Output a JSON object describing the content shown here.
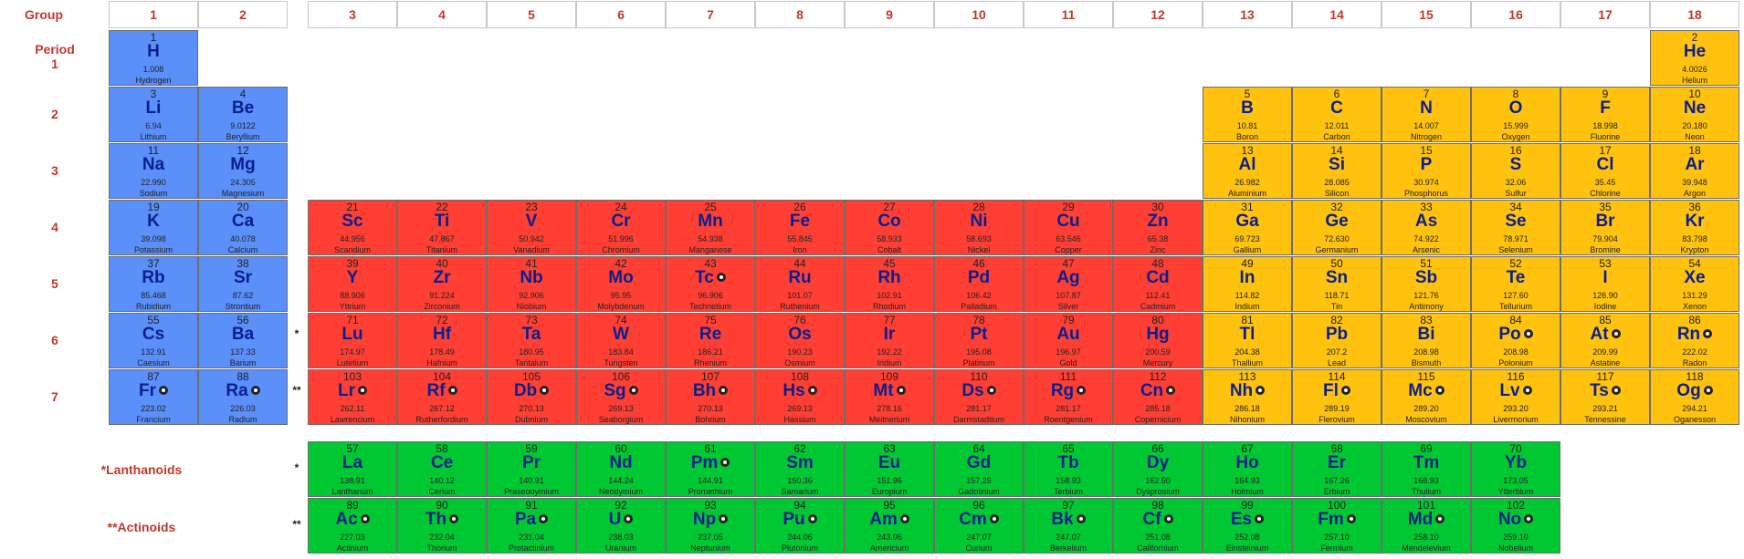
{
  "table_header": {
    "group_label": "Group",
    "period_label": "Period",
    "group_numbers": [
      "1",
      "2",
      "3",
      "4",
      "5",
      "6",
      "7",
      "8",
      "9",
      "10",
      "11",
      "12",
      "13",
      "14",
      "15",
      "16",
      "17",
      "18"
    ],
    "period_numbers": [
      "1",
      "2",
      "3",
      "4",
      "5",
      "6",
      "7"
    ]
  },
  "series_labels": {
    "lanthanoids": "*Lanthanoids",
    "actinoids": "**Actinoids",
    "lanthanoid_marker": "*",
    "actinoid_marker": "**"
  },
  "colors": {
    "s_block": "#5b8ff9",
    "p_block": "#ffc20e",
    "d_block": "#ff3f33",
    "f_block": "#00c832",
    "header_text": "#c0392b",
    "symbol_text": "#0b1f8c"
  },
  "elements": [
    {
      "n": 1,
      "s": "H",
      "m": "1.008",
      "name": "Hydrogen",
      "p": 1,
      "g": 1,
      "b": "s"
    },
    {
      "n": 2,
      "s": "He",
      "m": "4.0026",
      "name": "Helium",
      "p": 1,
      "g": 18,
      "b": "p"
    },
    {
      "n": 3,
      "s": "Li",
      "m": "6.94",
      "name": "Lithium",
      "p": 2,
      "g": 1,
      "b": "s"
    },
    {
      "n": 4,
      "s": "Be",
      "m": "9.0122",
      "name": "Beryllium",
      "p": 2,
      "g": 2,
      "b": "s"
    },
    {
      "n": 5,
      "s": "B",
      "m": "10.81",
      "name": "Boron",
      "p": 2,
      "g": 13,
      "b": "p"
    },
    {
      "n": 6,
      "s": "C",
      "m": "12.011",
      "name": "Carbon",
      "p": 2,
      "g": 14,
      "b": "p"
    },
    {
      "n": 7,
      "s": "N",
      "m": "14.007",
      "name": "Nitrogen",
      "p": 2,
      "g": 15,
      "b": "p"
    },
    {
      "n": 8,
      "s": "O",
      "m": "15.999",
      "name": "Oxygen",
      "p": 2,
      "g": 16,
      "b": "p"
    },
    {
      "n": 9,
      "s": "F",
      "m": "18.998",
      "name": "Fluorine",
      "p": 2,
      "g": 17,
      "b": "p"
    },
    {
      "n": 10,
      "s": "Ne",
      "m": "20.180",
      "name": "Neon",
      "p": 2,
      "g": 18,
      "b": "p"
    },
    {
      "n": 11,
      "s": "Na",
      "m": "22.990",
      "name": "Sodium",
      "p": 3,
      "g": 1,
      "b": "s"
    },
    {
      "n": 12,
      "s": "Mg",
      "m": "24.305",
      "name": "Magnesium",
      "p": 3,
      "g": 2,
      "b": "s"
    },
    {
      "n": 13,
      "s": "Al",
      "m": "26.982",
      "name": "Aluminium",
      "p": 3,
      "g": 13,
      "b": "p"
    },
    {
      "n": 14,
      "s": "Si",
      "m": "28.085",
      "name": "Silicon",
      "p": 3,
      "g": 14,
      "b": "p"
    },
    {
      "n": 15,
      "s": "P",
      "m": "30.974",
      "name": "Phosphorus",
      "p": 3,
      "g": 15,
      "b": "p"
    },
    {
      "n": 16,
      "s": "S",
      "m": "32.06",
      "name": "Sulfur",
      "p": 3,
      "g": 16,
      "b": "p"
    },
    {
      "n": 17,
      "s": "Cl",
      "m": "35.45",
      "name": "Chlorine",
      "p": 3,
      "g": 17,
      "b": "p"
    },
    {
      "n": 18,
      "s": "Ar",
      "m": "39.948",
      "name": "Argon",
      "p": 3,
      "g": 18,
      "b": "p"
    },
    {
      "n": 19,
      "s": "K",
      "m": "39.098",
      "name": "Potassium",
      "p": 4,
      "g": 1,
      "b": "s"
    },
    {
      "n": 20,
      "s": "Ca",
      "m": "40.078",
      "name": "Calcium",
      "p": 4,
      "g": 2,
      "b": "s"
    },
    {
      "n": 21,
      "s": "Sc",
      "m": "44.956",
      "name": "Scandium",
      "p": 4,
      "g": 3,
      "b": "d"
    },
    {
      "n": 22,
      "s": "Ti",
      "m": "47.867",
      "name": "Titanium",
      "p": 4,
      "g": 4,
      "b": "d"
    },
    {
      "n": 23,
      "s": "V",
      "m": "50.942",
      "name": "Vanadium",
      "p": 4,
      "g": 5,
      "b": "d"
    },
    {
      "n": 24,
      "s": "Cr",
      "m": "51.996",
      "name": "Chromium",
      "p": 4,
      "g": 6,
      "b": "d"
    },
    {
      "n": 25,
      "s": "Mn",
      "m": "54.938",
      "name": "Manganese",
      "p": 4,
      "g": 7,
      "b": "d"
    },
    {
      "n": 26,
      "s": "Fe",
      "m": "55.845",
      "name": "Iron",
      "p": 4,
      "g": 8,
      "b": "d"
    },
    {
      "n": 27,
      "s": "Co",
      "m": "58.933",
      "name": "Cobalt",
      "p": 4,
      "g": 9,
      "b": "d"
    },
    {
      "n": 28,
      "s": "Ni",
      "m": "58.693",
      "name": "Nickel",
      "p": 4,
      "g": 10,
      "b": "d"
    },
    {
      "n": 29,
      "s": "Cu",
      "m": "63.546",
      "name": "Copper",
      "p": 4,
      "g": 11,
      "b": "d"
    },
    {
      "n": 30,
      "s": "Zn",
      "m": "65.38",
      "name": "Zinc",
      "p": 4,
      "g": 12,
      "b": "d"
    },
    {
      "n": 31,
      "s": "Ga",
      "m": "69.723",
      "name": "Gallium",
      "p": 4,
      "g": 13,
      "b": "p"
    },
    {
      "n": 32,
      "s": "Ge",
      "m": "72.630",
      "name": "Germanium",
      "p": 4,
      "g": 14,
      "b": "p"
    },
    {
      "n": 33,
      "s": "As",
      "m": "74.922",
      "name": "Arsenic",
      "p": 4,
      "g": 15,
      "b": "p"
    },
    {
      "n": 34,
      "s": "Se",
      "m": "78.971",
      "name": "Selenium",
      "p": 4,
      "g": 16,
      "b": "p"
    },
    {
      "n": 35,
      "s": "Br",
      "m": "79.904",
      "name": "Bromine",
      "p": 4,
      "g": 17,
      "b": "p"
    },
    {
      "n": 36,
      "s": "Kr",
      "m": "83.798",
      "name": "Krypton",
      "p": 4,
      "g": 18,
      "b": "p"
    },
    {
      "n": 37,
      "s": "Rb",
      "m": "85.468",
      "name": "Rubidium",
      "p": 5,
      "g": 1,
      "b": "s"
    },
    {
      "n": 38,
      "s": "Sr",
      "m": "87.62",
      "name": "Strontium",
      "p": 5,
      "g": 2,
      "b": "s"
    },
    {
      "n": 39,
      "s": "Y",
      "m": "88.906",
      "name": "Yttrium",
      "p": 5,
      "g": 3,
      "b": "d"
    },
    {
      "n": 40,
      "s": "Zr",
      "m": "91.224",
      "name": "Zirconium",
      "p": 5,
      "g": 4,
      "b": "d"
    },
    {
      "n": 41,
      "s": "Nb",
      "m": "92.906",
      "name": "Niobium",
      "p": 5,
      "g": 5,
      "b": "d"
    },
    {
      "n": 42,
      "s": "Mo",
      "m": "95.95",
      "name": "Molybdenum",
      "p": 5,
      "g": 6,
      "b": "d"
    },
    {
      "n": 43,
      "s": "Tc",
      "m": "96.906",
      "name": "Technetium",
      "p": 5,
      "g": 7,
      "b": "d",
      "r": true
    },
    {
      "n": 44,
      "s": "Ru",
      "m": "101.07",
      "name": "Ruthenium",
      "p": 5,
      "g": 8,
      "b": "d"
    },
    {
      "n": 45,
      "s": "Rh",
      "m": "102.91",
      "name": "Rhodium",
      "p": 5,
      "g": 9,
      "b": "d"
    },
    {
      "n": 46,
      "s": "Pd",
      "m": "106.42",
      "name": "Palladium",
      "p": 5,
      "g": 10,
      "b": "d"
    },
    {
      "n": 47,
      "s": "Ag",
      "m": "107.87",
      "name": "Silver",
      "p": 5,
      "g": 11,
      "b": "d"
    },
    {
      "n": 48,
      "s": "Cd",
      "m": "112.41",
      "name": "Cadmium",
      "p": 5,
      "g": 12,
      "b": "d"
    },
    {
      "n": 49,
      "s": "In",
      "m": "114.82",
      "name": "Indium",
      "p": 5,
      "g": 13,
      "b": "p"
    },
    {
      "n": 50,
      "s": "Sn",
      "m": "118.71",
      "name": "Tin",
      "p": 5,
      "g": 14,
      "b": "p"
    },
    {
      "n": 51,
      "s": "Sb",
      "m": "121.76",
      "name": "Antimony",
      "p": 5,
      "g": 15,
      "b": "p"
    },
    {
      "n": 52,
      "s": "Te",
      "m": "127.60",
      "name": "Tellurium",
      "p": 5,
      "g": 16,
      "b": "p"
    },
    {
      "n": 53,
      "s": "I",
      "m": "126.90",
      "name": "Iodine",
      "p": 5,
      "g": 17,
      "b": "p"
    },
    {
      "n": 54,
      "s": "Xe",
      "m": "131.29",
      "name": "Xenon",
      "p": 5,
      "g": 18,
      "b": "p"
    },
    {
      "n": 55,
      "s": "Cs",
      "m": "132.91",
      "name": "Caesium",
      "p": 6,
      "g": 1,
      "b": "s"
    },
    {
      "n": 56,
      "s": "Ba",
      "m": "137.33",
      "name": "Barium",
      "p": 6,
      "g": 2,
      "b": "s"
    },
    {
      "n": 71,
      "s": "Lu",
      "m": "174.97",
      "name": "Lutetium",
      "p": 6,
      "g": 3,
      "b": "d"
    },
    {
      "n": 72,
      "s": "Hf",
      "m": "178.49",
      "name": "Hafnium",
      "p": 6,
      "g": 4,
      "b": "d"
    },
    {
      "n": 73,
      "s": "Ta",
      "m": "180.95",
      "name": "Tantalum",
      "p": 6,
      "g": 5,
      "b": "d"
    },
    {
      "n": 74,
      "s": "W",
      "m": "183.84",
      "name": "Tungsten",
      "p": 6,
      "g": 6,
      "b": "d"
    },
    {
      "n": 75,
      "s": "Re",
      "m": "186.21",
      "name": "Rhenium",
      "p": 6,
      "g": 7,
      "b": "d"
    },
    {
      "n": 76,
      "s": "Os",
      "m": "190.23",
      "name": "Osmium",
      "p": 6,
      "g": 8,
      "b": "d"
    },
    {
      "n": 77,
      "s": "Ir",
      "m": "192.22",
      "name": "Iridium",
      "p": 6,
      "g": 9,
      "b": "d"
    },
    {
      "n": 78,
      "s": "Pt",
      "m": "195.08",
      "name": "Platinum",
      "p": 6,
      "g": 10,
      "b": "d"
    },
    {
      "n": 79,
      "s": "Au",
      "m": "196.97",
      "name": "Gold",
      "p": 6,
      "g": 11,
      "b": "d"
    },
    {
      "n": 80,
      "s": "Hg",
      "m": "200.59",
      "name": "Mercury",
      "p": 6,
      "g": 12,
      "b": "d"
    },
    {
      "n": 81,
      "s": "Tl",
      "m": "204.38",
      "name": "Thallium",
      "p": 6,
      "g": 13,
      "b": "p"
    },
    {
      "n": 82,
      "s": "Pb",
      "m": "207.2",
      "name": "Lead",
      "p": 6,
      "g": 14,
      "b": "p"
    },
    {
      "n": 83,
      "s": "Bi",
      "m": "208.98",
      "name": "Bismuth",
      "p": 6,
      "g": 15,
      "b": "p"
    },
    {
      "n": 84,
      "s": "Po",
      "m": "208.98",
      "name": "Polonium",
      "p": 6,
      "g": 16,
      "b": "p",
      "r": true
    },
    {
      "n": 85,
      "s": "At",
      "m": "209.99",
      "name": "Astatine",
      "p": 6,
      "g": 17,
      "b": "p",
      "r": true
    },
    {
      "n": 86,
      "s": "Rn",
      "m": "222.02",
      "name": "Radon",
      "p": 6,
      "g": 18,
      "b": "p",
      "r": true
    },
    {
      "n": 87,
      "s": "Fr",
      "m": "223.02",
      "name": "Francium",
      "p": 7,
      "g": 1,
      "b": "s",
      "r": true
    },
    {
      "n": 88,
      "s": "Ra",
      "m": "226.03",
      "name": "Radium",
      "p": 7,
      "g": 2,
      "b": "s",
      "r": true
    },
    {
      "n": 103,
      "s": "Lr",
      "m": "262.11",
      "name": "Lawrencium",
      "p": 7,
      "g": 3,
      "b": "d",
      "r": true
    },
    {
      "n": 104,
      "s": "Rf",
      "m": "267.12",
      "name": "Rutherfordium",
      "p": 7,
      "g": 4,
      "b": "d",
      "r": true
    },
    {
      "n": 105,
      "s": "Db",
      "m": "270.13",
      "name": "Dubnium",
      "p": 7,
      "g": 5,
      "b": "d",
      "r": true
    },
    {
      "n": 106,
      "s": "Sg",
      "m": "269.13",
      "name": "Seaborgium",
      "p": 7,
      "g": 6,
      "b": "d",
      "r": true
    },
    {
      "n": 107,
      "s": "Bh",
      "m": "270.13",
      "name": "Bohrium",
      "p": 7,
      "g": 7,
      "b": "d",
      "r": true
    },
    {
      "n": 108,
      "s": "Hs",
      "m": "269.13",
      "name": "Hassium",
      "p": 7,
      "g": 8,
      "b": "d",
      "r": true
    },
    {
      "n": 109,
      "s": "Mt",
      "m": "278.16",
      "name": "Meitnerium",
      "p": 7,
      "g": 9,
      "b": "d",
      "r": true
    },
    {
      "n": 110,
      "s": "Ds",
      "m": "281.17",
      "name": "Darmstadtium",
      "p": 7,
      "g": 10,
      "b": "d",
      "r": true
    },
    {
      "n": 111,
      "s": "Rg",
      "m": "281.17",
      "name": "Roentgenium",
      "p": 7,
      "g": 11,
      "b": "d",
      "r": true
    },
    {
      "n": 112,
      "s": "Cn",
      "m": "285.18",
      "name": "Copernicium",
      "p": 7,
      "g": 12,
      "b": "d",
      "r": true
    },
    {
      "n": 113,
      "s": "Nh",
      "m": "286.18",
      "name": "Nihonium",
      "p": 7,
      "g": 13,
      "b": "p",
      "r": true
    },
    {
      "n": 114,
      "s": "Fl",
      "m": "289.19",
      "name": "Flerovium",
      "p": 7,
      "g": 14,
      "b": "p",
      "r": true
    },
    {
      "n": 115,
      "s": "Mc",
      "m": "289.20",
      "name": "Moscovium",
      "p": 7,
      "g": 15,
      "b": "p",
      "r": true
    },
    {
      "n": 116,
      "s": "Lv",
      "m": "293.20",
      "name": "Livermorium",
      "p": 7,
      "g": 16,
      "b": "p",
      "r": true
    },
    {
      "n": 117,
      "s": "Ts",
      "m": "293.21",
      "name": "Tennessine",
      "p": 7,
      "g": 17,
      "b": "p",
      "r": true
    },
    {
      "n": 118,
      "s": "Og",
      "m": "294.21",
      "name": "Oganesson",
      "p": 7,
      "g": 18,
      "b": "p",
      "r": true
    },
    {
      "n": 57,
      "s": "La",
      "m": "138.91",
      "name": "Lanthanum",
      "p": 8,
      "g": 3,
      "b": "f"
    },
    {
      "n": 58,
      "s": "Ce",
      "m": "140.12",
      "name": "Cerium",
      "p": 8,
      "g": 4,
      "b": "f"
    },
    {
      "n": 59,
      "s": "Pr",
      "m": "140.91",
      "name": "Praseodymium",
      "p": 8,
      "g": 5,
      "b": "f"
    },
    {
      "n": 60,
      "s": "Nd",
      "m": "144.24",
      "name": "Neodymium",
      "p": 8,
      "g": 6,
      "b": "f"
    },
    {
      "n": 61,
      "s": "Pm",
      "m": "144.91",
      "name": "Promethium",
      "p": 8,
      "g": 7,
      "b": "f",
      "r": true
    },
    {
      "n": 62,
      "s": "Sm",
      "m": "150.36",
      "name": "Samarium",
      "p": 8,
      "g": 8,
      "b": "f"
    },
    {
      "n": 63,
      "s": "Eu",
      "m": "151.96",
      "name": "Europium",
      "p": 8,
      "g": 9,
      "b": "f"
    },
    {
      "n": 64,
      "s": "Gd",
      "m": "157.25",
      "name": "Gadolinium",
      "p": 8,
      "g": 10,
      "b": "f"
    },
    {
      "n": 65,
      "s": "Tb",
      "m": "158.93",
      "name": "Terbium",
      "p": 8,
      "g": 11,
      "b": "f"
    },
    {
      "n": 66,
      "s": "Dy",
      "m": "162.50",
      "name": "Dysprosium",
      "p": 8,
      "g": 12,
      "b": "f"
    },
    {
      "n": 67,
      "s": "Ho",
      "m": "164.93",
      "name": "Holmium",
      "p": 8,
      "g": 13,
      "b": "f"
    },
    {
      "n": 68,
      "s": "Er",
      "m": "167.26",
      "name": "Erbium",
      "p": 8,
      "g": 14,
      "b": "f"
    },
    {
      "n": 69,
      "s": "Tm",
      "m": "168.93",
      "name": "Thulium",
      "p": 8,
      "g": 15,
      "b": "f"
    },
    {
      "n": 70,
      "s": "Yb",
      "m": "173.05",
      "name": "Ytterbium",
      "p": 8,
      "g": 16,
      "b": "f"
    },
    {
      "n": 89,
      "s": "Ac",
      "m": "227.03",
      "name": "Actinium",
      "p": 9,
      "g": 3,
      "b": "f",
      "r": true
    },
    {
      "n": 90,
      "s": "Th",
      "m": "232.04",
      "name": "Thorium",
      "p": 9,
      "g": 4,
      "b": "f",
      "r": true
    },
    {
      "n": 91,
      "s": "Pa",
      "m": "231.04",
      "name": "Protactinium",
      "p": 9,
      "g": 5,
      "b": "f",
      "r": true
    },
    {
      "n": 92,
      "s": "U",
      "m": "238.03",
      "name": "Uranium",
      "p": 9,
      "g": 6,
      "b": "f",
      "r": true
    },
    {
      "n": 93,
      "s": "Np",
      "m": "237.05",
      "name": "Neptunium",
      "p": 9,
      "g": 7,
      "b": "f",
      "r": true
    },
    {
      "n": 94,
      "s": "Pu",
      "m": "244.06",
      "name": "Plutonium",
      "p": 9,
      "g": 8,
      "b": "f",
      "r": true
    },
    {
      "n": 95,
      "s": "Am",
      "m": "243.06",
      "name": "Americium",
      "p": 9,
      "g": 9,
      "b": "f",
      "r": true
    },
    {
      "n": 96,
      "s": "Cm",
      "m": "247.07",
      "name": "Curium",
      "p": 9,
      "g": 10,
      "b": "f",
      "r": true
    },
    {
      "n": 97,
      "s": "Bk",
      "m": "247.07",
      "name": "Berkelium",
      "p": 9,
      "g": 11,
      "b": "f",
      "r": true
    },
    {
      "n": 98,
      "s": "Cf",
      "m": "251.08",
      "name": "Californium",
      "p": 9,
      "g": 12,
      "b": "f",
      "r": true
    },
    {
      "n": 99,
      "s": "Es",
      "m": "252.08",
      "name": "Einsteinium",
      "p": 9,
      "g": 13,
      "b": "f",
      "r": true
    },
    {
      "n": 100,
      "s": "Fm",
      "m": "257.10",
      "name": "Fermium",
      "p": 9,
      "g": 14,
      "b": "f",
      "r": true
    },
    {
      "n": 101,
      "s": "Md",
      "m": "258.10",
      "name": "Mendelevium",
      "p": 9,
      "g": 15,
      "b": "f",
      "r": true
    },
    {
      "n": 102,
      "s": "No",
      "m": "259.10",
      "name": "Nobelium",
      "p": 9,
      "g": 16,
      "b": "f",
      "r": true
    }
  ]
}
